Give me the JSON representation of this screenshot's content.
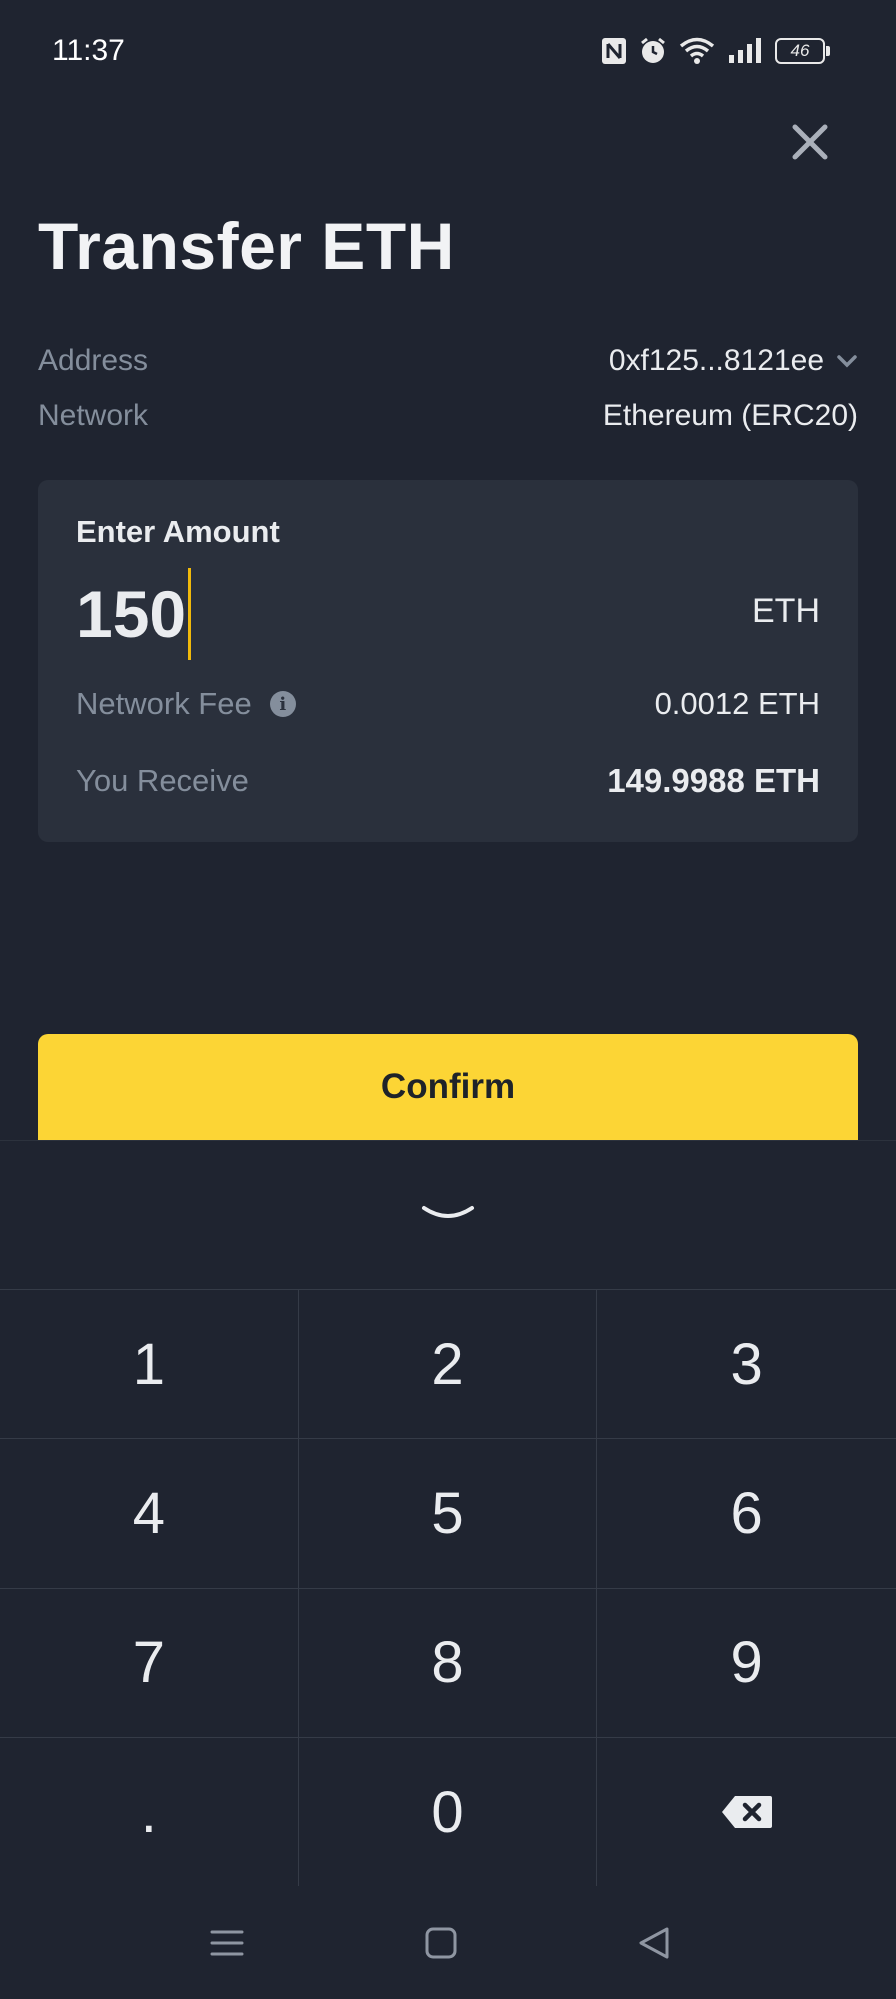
{
  "status_bar": {
    "time": "11:37",
    "battery": "46",
    "icons": [
      "nfc-icon",
      "alarm-icon",
      "wifi-icon",
      "signal-icon",
      "battery-icon"
    ]
  },
  "header": {
    "title": "Transfer ETH",
    "close_icon": "close-icon"
  },
  "details": {
    "address_label": "Address",
    "address_value": "0xf125...8121ee",
    "network_label": "Network",
    "network_value": "Ethereum (ERC20)"
  },
  "amount_card": {
    "title": "Enter Amount",
    "amount_value": "150",
    "unit": "ETH",
    "fee_label": "Network Fee",
    "fee_value": "0.0012 ETH",
    "receive_label": "You Receive",
    "receive_value": "149.9988 ETH"
  },
  "confirm_label": "Confirm",
  "keypad": {
    "keys": [
      "1",
      "2",
      "3",
      "4",
      "5",
      "6",
      "7",
      "8",
      "9",
      ".",
      "0"
    ],
    "backspace_icon": "backspace-icon",
    "hide_icon": "chevron-down-icon"
  },
  "colors": {
    "background": "#1f2430",
    "card": "#2a303c",
    "accent": "#fcd535",
    "muted_text": "#848e9c"
  }
}
